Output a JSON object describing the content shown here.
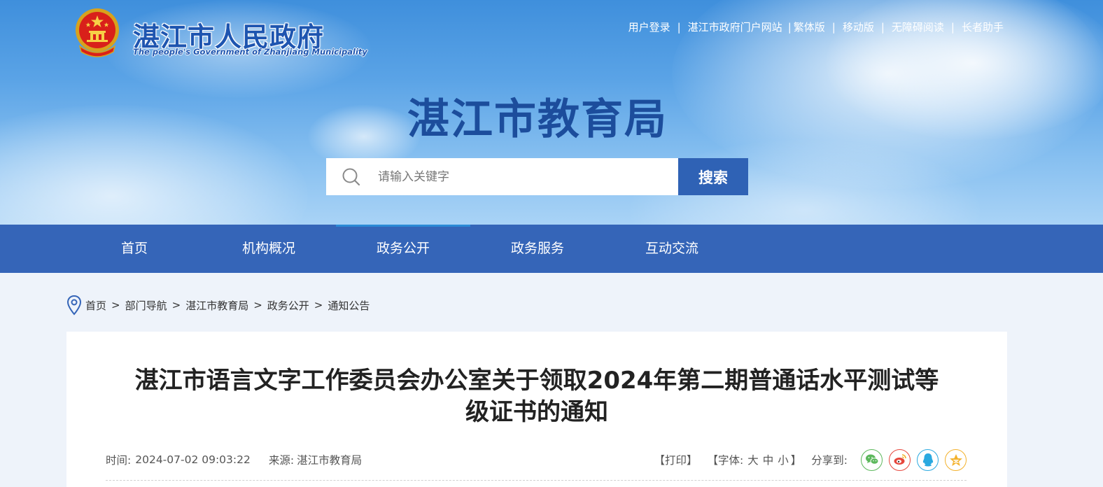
{
  "header": {
    "gov_name_cn": "湛江市人民政府",
    "gov_name_en": "The people's Government of Zhanjiang Municipality",
    "top_links": [
      "用户登录",
      "湛江市政府门户网站",
      "繁体版",
      "移动版",
      "无障碍阅读",
      "长者助手"
    ],
    "bureau_title": "湛江市教育局"
  },
  "search": {
    "placeholder": "请输入关键字",
    "button_label": "搜索"
  },
  "nav": {
    "items": [
      "首页",
      "机构概况",
      "政务公开",
      "政务服务",
      "互动交流"
    ],
    "active": "政务公开"
  },
  "breadcrumb": [
    "首页",
    "部门导航",
    "湛江市教育局",
    "政务公开",
    "通知公告"
  ],
  "article": {
    "title_line1": "湛江市语言文字工作委员会办公室关于领取2024年第二期普通话水平测试等",
    "title_line2": "级证书的通知",
    "time_label": "时间:",
    "time_value": "2024-07-02 09:03:22",
    "source_label": "来源:",
    "source_value": "湛江市教育局",
    "print_label": "【打印】",
    "font_label": "【字体:",
    "font_large": "大",
    "font_medium": "中",
    "font_small": "小",
    "font_close": "】",
    "share_label": "分享到:",
    "share_icons": [
      "wechat-icon",
      "weibo-icon",
      "qq-icon",
      "qzone-icon"
    ]
  },
  "colors": {
    "nav_bg": "#3565b8",
    "search_button": "#2f62b5",
    "title_blue": "#1c4d9c",
    "page_bg": "#eef3fa",
    "wechat": "#5cb85c",
    "weibo": "#e6463c",
    "qq": "#2aa9e0",
    "qzone": "#f3b12b"
  }
}
